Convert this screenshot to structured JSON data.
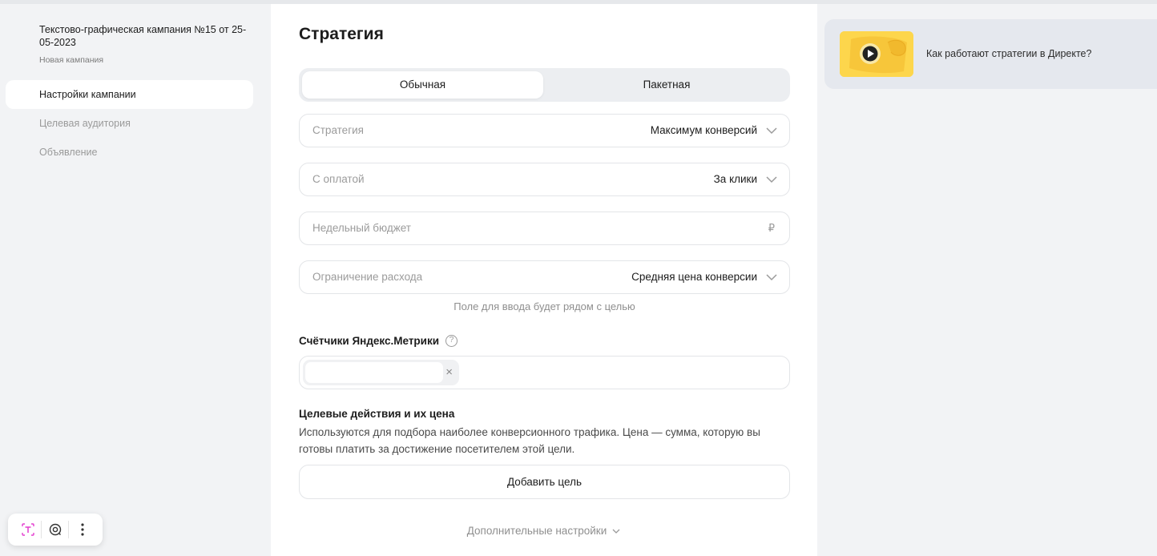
{
  "sidebar": {
    "campaign_title": "Текстово-графическая кампания №15 от 25-05-2023",
    "campaign_subtitle": "Новая кампания",
    "items": [
      {
        "label": "Настройки кампании",
        "active": true
      },
      {
        "label": "Целевая аудитория",
        "active": false
      },
      {
        "label": "Объявление",
        "active": false
      }
    ]
  },
  "main": {
    "title": "Стратегия",
    "tabs": [
      {
        "label": "Обычная",
        "selected": true
      },
      {
        "label": "Пакетная",
        "selected": false
      }
    ],
    "fields": {
      "strategy": {
        "label": "Стратегия",
        "value": "Максимум конверсий"
      },
      "payment": {
        "label": "С оплатой",
        "value": "За клики"
      },
      "budget": {
        "placeholder": "Недельный бюджет",
        "currency": "₽"
      },
      "limit": {
        "label": "Ограничение расхода",
        "value": "Средняя цена конверсии"
      }
    },
    "limit_hint": "Поле для ввода будет рядом с целью",
    "metrika": {
      "label": "Счётчики Яндекс.Метрики",
      "help_glyph": "?",
      "chip_remove": "×"
    },
    "goals": {
      "title": "Целевые действия и их цена",
      "description": "Используются для подбора наиболее конверсионного трафика. Цена — сумма, которую вы готовы платить за достижение посетителем этой цели.",
      "add_label": "Добавить цель"
    },
    "more_settings": "Дополнительные настройки"
  },
  "help_panel": {
    "video_title": "Как работают стратегии в Директе?"
  },
  "toolbar": {
    "items": [
      "text-select-icon",
      "lens-icon",
      "more-vertical-icon"
    ]
  },
  "colors": {
    "page_bg": "#f2f3f5",
    "card_bg": "#ffffff",
    "field_border": "#e3e5e8",
    "muted_text": "#9b9b9b",
    "thumb_yellow": "#fdd64c",
    "accent_pink": "#e43ecf"
  }
}
